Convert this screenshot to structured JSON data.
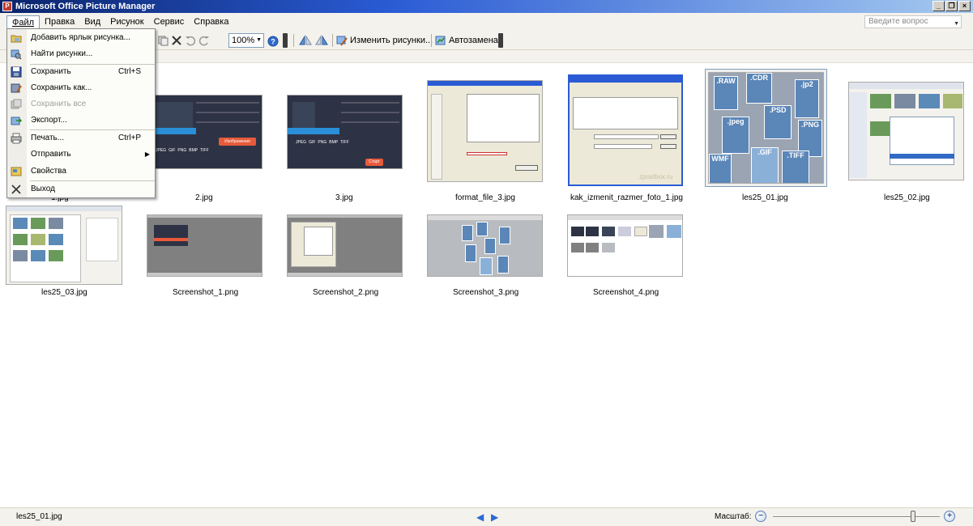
{
  "window": {
    "title": "Microsoft Office Picture Manager",
    "controls": [
      "_",
      "ð",
      "×"
    ]
  },
  "menubar": {
    "items": [
      "Файл",
      "Правка",
      "Вид",
      "Рисунок",
      "Сервис",
      "Справка"
    ],
    "ask_placeholder": "Введите вопрос"
  },
  "toolbar": {
    "zoom": "100%",
    "edit_pictures": "Изменить рисунки...",
    "autocorrect": "Автозамена"
  },
  "file_menu": {
    "items": [
      {
        "label": "Добавить ярлык рисунка...",
        "shortcut": "",
        "icon": "add-shortcut-icon",
        "enabled": true
      },
      {
        "label": "Найти рисунки...",
        "shortcut": "",
        "icon": "find-pictures-icon",
        "enabled": true
      },
      {
        "label": "Сохранить",
        "shortcut": "Ctrl+S",
        "icon": "save-icon",
        "enabled": true
      },
      {
        "label": "Сохранить как...",
        "shortcut": "",
        "icon": "save-as-icon",
        "enabled": true
      },
      {
        "label": "Сохранить все",
        "shortcut": "",
        "icon": "save-all-icon",
        "enabled": false
      },
      {
        "label": "Экспорт...",
        "shortcut": "",
        "icon": "export-icon",
        "enabled": true
      },
      {
        "label": "Печать...",
        "shortcut": "Ctrl+P",
        "icon": "print-icon",
        "enabled": true
      },
      {
        "label": "Отправить",
        "shortcut": "",
        "icon": "",
        "enabled": true,
        "submenu": true
      },
      {
        "label": "Свойства",
        "shortcut": "",
        "icon": "properties-icon",
        "enabled": true
      },
      {
        "label": "Выход",
        "shortcut": "",
        "icon": "close-icon",
        "enabled": true
      }
    ]
  },
  "thumbnails": [
    {
      "caption": "1.jpg"
    },
    {
      "caption": "2.jpg"
    },
    {
      "caption": "3.jpg"
    },
    {
      "caption": "format_file_3.jpg"
    },
    {
      "caption": "kak_izmenit_razmer_foto_1.jpg"
    },
    {
      "caption": "les25_01.jpg",
      "selected": true
    },
    {
      "caption": "les25_02.jpg"
    },
    {
      "caption": "les25_03.jpg"
    },
    {
      "caption": "Screenshot_1.png"
    },
    {
      "caption": "Screenshot_2.png"
    },
    {
      "caption": "Screenshot_3.png"
    },
    {
      "caption": "Screenshot_4.png"
    }
  ],
  "formats_image": {
    "labels": [
      ".RAW",
      ".CDR",
      ".jp2",
      ".PSD",
      ".jpeg",
      ".PNG",
      "WMF",
      ".GIF",
      ".TIFF"
    ]
  },
  "format_buttons": [
    "JPEG",
    "GIF",
    "PNG",
    "BMP",
    "TIFF"
  ],
  "badge_convert": "Изображения",
  "badge_start": "Старт",
  "watermark": "zpostbox.ru",
  "statusbar": {
    "current_file": "les25_01.jpg",
    "zoom_label": "Масштаб:",
    "zoom_level": 0.84
  }
}
